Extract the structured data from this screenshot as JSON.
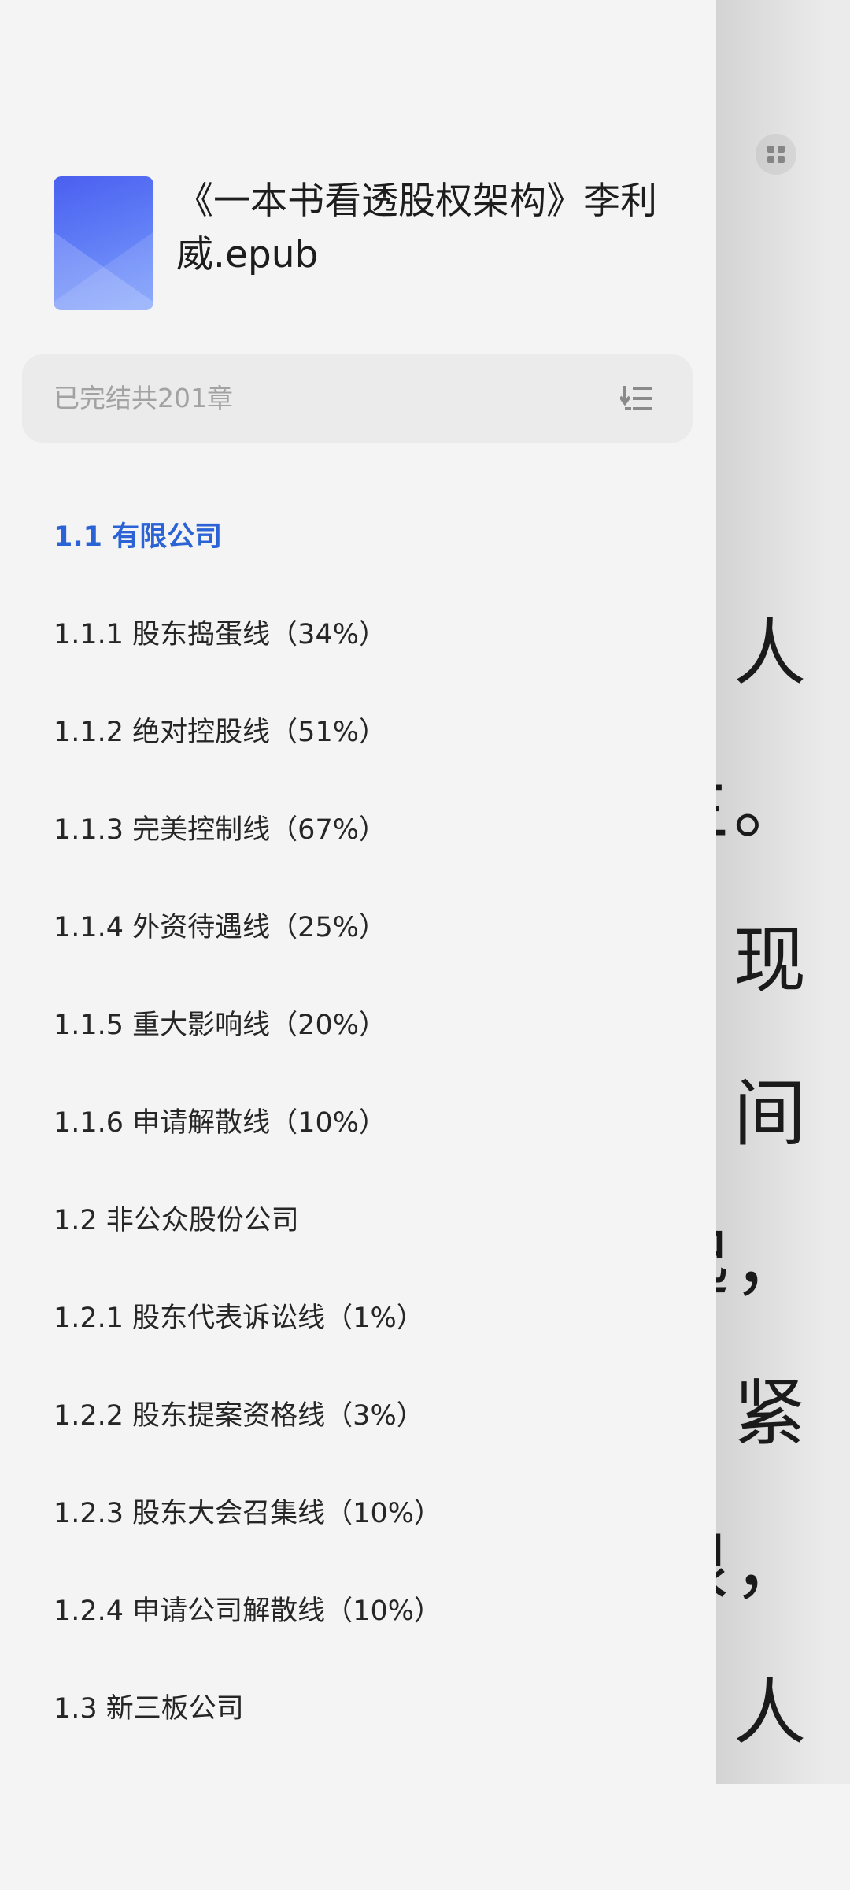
{
  "reader": {
    "lines": [
      "人",
      "生。",
      "现",
      "间",
      "起，",
      "紧",
      "限，",
      "人"
    ]
  },
  "drawer": {
    "book_title": "《一本书看透股权架构》李利威.epub",
    "status": "已完结共201章",
    "toc": [
      {
        "label": "1.1 有限公司",
        "active": true
      },
      {
        "label": "1.1.1 股东捣蛋线（34%）",
        "active": false
      },
      {
        "label": "1.1.2 绝对控股线（51%）",
        "active": false
      },
      {
        "label": "1.1.3 完美控制线（67%）",
        "active": false
      },
      {
        "label": "1.1.4 外资待遇线（25%）",
        "active": false
      },
      {
        "label": "1.1.5 重大影响线（20%）",
        "active": false
      },
      {
        "label": "1.1.6 申请解散线（10%）",
        "active": false
      },
      {
        "label": "1.2 非公众股份公司",
        "active": false
      },
      {
        "label": "1.2.1 股东代表诉讼线（1%）",
        "active": false
      },
      {
        "label": "1.2.2 股东提案资格线（3%）",
        "active": false
      },
      {
        "label": "1.2.3 股东大会召集线（10%）",
        "active": false
      },
      {
        "label": "1.2.4 申请公司解散线（10%）",
        "active": false
      },
      {
        "label": "1.3 新三板公司",
        "active": false
      }
    ]
  },
  "colors": {
    "accent": "#2b63d6",
    "cover_top": "#4a5ff0",
    "cover_bottom": "#7fa1fb"
  },
  "icons": [
    "grid-menu-icon",
    "sort-order-icon",
    "book-cover-icon"
  ]
}
